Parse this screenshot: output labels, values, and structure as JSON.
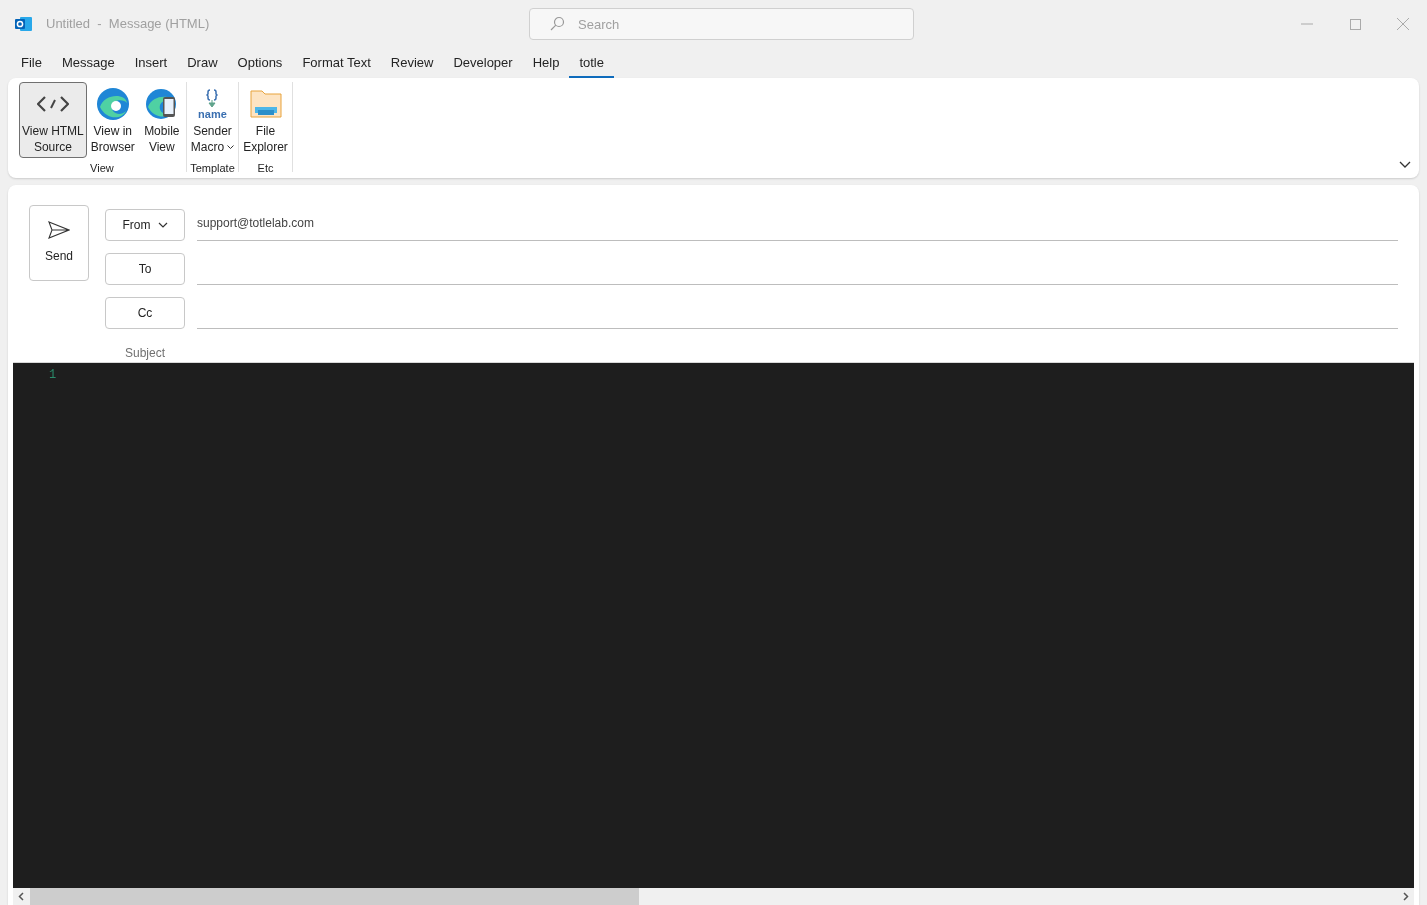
{
  "window": {
    "title": "Untitled  -  Message (HTML)"
  },
  "search": {
    "placeholder": "Search"
  },
  "tabs": [
    {
      "label": "File",
      "selected": false
    },
    {
      "label": "Message",
      "selected": false
    },
    {
      "label": "Insert",
      "selected": false
    },
    {
      "label": "Draw",
      "selected": false
    },
    {
      "label": "Options",
      "selected": false
    },
    {
      "label": "Format Text",
      "selected": false
    },
    {
      "label": "Review",
      "selected": false
    },
    {
      "label": "Developer",
      "selected": false
    },
    {
      "label": "Help",
      "selected": false
    },
    {
      "label": "totle",
      "selected": true
    }
  ],
  "ribbon": {
    "groups": [
      {
        "label": "View",
        "buttons": [
          {
            "kind": "code",
            "lines": [
              "View HTML",
              "Source"
            ],
            "selected": true,
            "dropdown": false
          },
          {
            "kind": "browser",
            "lines": [
              "View in",
              "Browser"
            ],
            "selected": false,
            "dropdown": false
          },
          {
            "kind": "mobile",
            "lines": [
              "Mobile",
              "View"
            ],
            "selected": false,
            "dropdown": false
          }
        ]
      },
      {
        "label": "Template",
        "buttons": [
          {
            "kind": "macro",
            "icon_text": "name",
            "lines": [
              "Sender",
              "Macro"
            ],
            "selected": false,
            "dropdown": true
          }
        ]
      },
      {
        "label": "Etc",
        "buttons": [
          {
            "kind": "folder",
            "lines": [
              "File",
              "Explorer"
            ],
            "selected": false,
            "dropdown": false
          }
        ]
      }
    ]
  },
  "compose": {
    "send": "Send",
    "fields": [
      {
        "label": "From",
        "dropdown": true,
        "value": "support@totlelab.com"
      },
      {
        "label": "To",
        "dropdown": false
      },
      {
        "label": "Cc",
        "dropdown": false
      }
    ],
    "subject_label": "Subject"
  },
  "editor": {
    "line_numbers": [
      "1"
    ]
  }
}
